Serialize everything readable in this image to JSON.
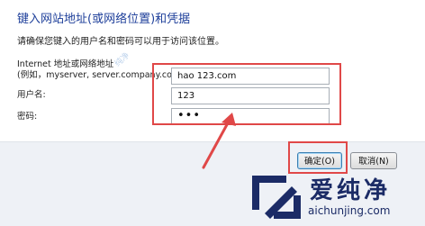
{
  "dialog": {
    "title": "键入网站地址(或网络位置)和凭据",
    "description": "请确保您键入的用户名和密码可以用于访问该位置。"
  },
  "form": {
    "address_label_line1": "Internet 地址或网络地址",
    "address_label_line2": "(例如，myserver, server.company.com):",
    "address_value": "hao 123.com",
    "username_label": "用户名:",
    "username_value": "123",
    "password_label": "密码:",
    "password_value": "•••"
  },
  "buttons": {
    "ok_label": "确定(O)",
    "cancel_label": "取消(N)"
  },
  "watermark": {
    "text": "爱纯净",
    "url": "aichunjing.com",
    "stamp_text": "纯净"
  },
  "colors": {
    "title": "#1e3f9a",
    "highlight": "#e04848",
    "footer": "#eef1f6",
    "watermark": "#1b2b66"
  }
}
